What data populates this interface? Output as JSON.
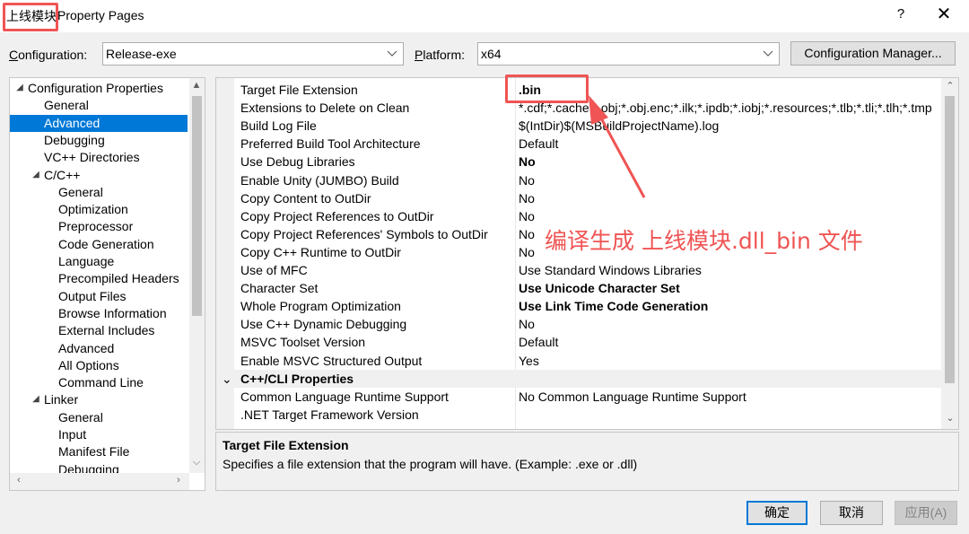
{
  "window": {
    "title_prefix": "上线模块",
    "title_rest": "Property Pages",
    "help_label": "?",
    "close_label": "✕"
  },
  "config": {
    "configuration_label_first": "C",
    "configuration_label_rest": "onfiguration:",
    "configuration_value": "Release-exe",
    "platform_label_first": "P",
    "platform_label_rest": "latform:",
    "platform_value": "x64",
    "manager_label": "Configuration Manager..."
  },
  "tree": {
    "items": [
      {
        "label": "Configuration Properties",
        "level": 0,
        "caret": "◢"
      },
      {
        "label": "General",
        "level": 1
      },
      {
        "label": "Advanced",
        "level": 1,
        "selected": true
      },
      {
        "label": "Debugging",
        "level": 1
      },
      {
        "label": "VC++ Directories",
        "level": 1
      },
      {
        "label": "C/C++",
        "level": 1,
        "caret": "◢"
      },
      {
        "label": "General",
        "level": 2
      },
      {
        "label": "Optimization",
        "level": 2
      },
      {
        "label": "Preprocessor",
        "level": 2
      },
      {
        "label": "Code Generation",
        "level": 2
      },
      {
        "label": "Language",
        "level": 2
      },
      {
        "label": "Precompiled Headers",
        "level": 2
      },
      {
        "label": "Output Files",
        "level": 2
      },
      {
        "label": "Browse Information",
        "level": 2
      },
      {
        "label": "External Includes",
        "level": 2
      },
      {
        "label": "Advanced",
        "level": 2
      },
      {
        "label": "All Options",
        "level": 2
      },
      {
        "label": "Command Line",
        "level": 2
      },
      {
        "label": "Linker",
        "level": 1,
        "caret": "◢"
      },
      {
        "label": "General",
        "level": 2
      },
      {
        "label": "Input",
        "level": 2
      },
      {
        "label": "Manifest File",
        "level": 2
      },
      {
        "label": "Debugging",
        "level": 2
      }
    ]
  },
  "grid": {
    "rows": [
      {
        "name": "Target File Extension",
        "value": ".bin",
        "bold": true
      },
      {
        "name": "Extensions to Delete on Clean",
        "value": "*.cdf;*.cache;*.obj;*.obj.enc;*.ilk;*.ipdb;*.iobj;*.resources;*.tlb;*.tli;*.tlh;*.tmp"
      },
      {
        "name": "Build Log File",
        "value": "$(IntDir)$(MSBuildProjectName).log"
      },
      {
        "name": "Preferred Build Tool Architecture",
        "value": "Default"
      },
      {
        "name": "Use Debug Libraries",
        "value": "No",
        "bold": true
      },
      {
        "name": "Enable Unity (JUMBO) Build",
        "value": "No"
      },
      {
        "name": "Copy Content to OutDir",
        "value": "No"
      },
      {
        "name": "Copy Project References to OutDir",
        "value": "No"
      },
      {
        "name": "Copy Project References' Symbols to OutDir",
        "value": "No"
      },
      {
        "name": "Copy C++ Runtime to OutDir",
        "value": "No"
      },
      {
        "name": "Use of MFC",
        "value": "Use Standard Windows Libraries"
      },
      {
        "name": "Character Set",
        "value": "Use Unicode Character Set",
        "bold": true
      },
      {
        "name": "Whole Program Optimization",
        "value": "Use Link Time Code Generation",
        "bold": true
      },
      {
        "name": "Use C++ Dynamic Debugging",
        "value": "No"
      },
      {
        "name": "MSVC Toolset Version",
        "value": "Default"
      },
      {
        "name": "Enable MSVC Structured Output",
        "value": "Yes"
      },
      {
        "name": "C++/CLI Properties",
        "value": "",
        "category": true
      },
      {
        "name": "Common Language Runtime Support",
        "value": "No Common Language Runtime Support"
      },
      {
        "name": ".NET Target Framework Version",
        "value": ""
      }
    ]
  },
  "description": {
    "title": "Target File Extension",
    "text": "Specifies a file extension that the program will have. (Example: .exe or .dll)"
  },
  "buttons": {
    "ok": "确定",
    "cancel": "取消",
    "apply": "应用(A)"
  },
  "annotation": {
    "text": "编译生成 上线模块.dll_bin 文件",
    "color": "#f05454"
  },
  "colors": {
    "selection": "#0078d7",
    "annotation": "#f05454"
  }
}
